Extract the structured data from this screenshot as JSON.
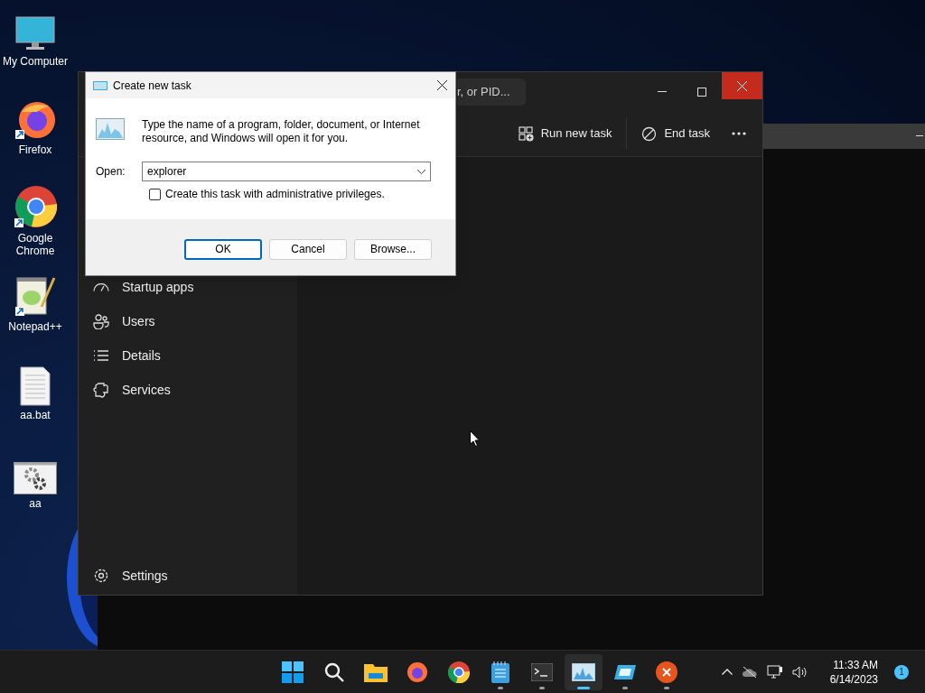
{
  "desktop_icons": [
    {
      "kind": "computer",
      "label": "My Computer"
    },
    {
      "kind": "firefox",
      "label": "Firefox"
    },
    {
      "kind": "chrome",
      "label": "Google Chrome"
    },
    {
      "kind": "notepadpp",
      "label": "Notepad++"
    },
    {
      "kind": "file",
      "label": "aa.bat"
    },
    {
      "kind": "app",
      "label": "aa"
    }
  ],
  "task_manager": {
    "search_placeholder": "r, or PID...",
    "toolbar": [
      {
        "kind": "run",
        "label": "Run new task"
      },
      {
        "kind": "end",
        "label": "End task"
      }
    ],
    "sidebar": [
      {
        "kind": "startup",
        "label": "Startup apps"
      },
      {
        "kind": "users",
        "label": "Users"
      },
      {
        "kind": "details",
        "label": "Details"
      },
      {
        "kind": "services",
        "label": "Services"
      }
    ],
    "settings": {
      "label": "Settings"
    }
  },
  "dialog": {
    "title": "Create new task",
    "description": "Type the name of a program, folder, document, or Internet resource, and Windows will open it for you.",
    "open_label": "Open:",
    "open_value": "explorer",
    "checkbox": {
      "label": "Create this task with administrative privileges.",
      "checked": false
    },
    "buttons": [
      {
        "label": "OK",
        "default": true
      },
      {
        "label": "Cancel",
        "default": false
      },
      {
        "label": "Browse...",
        "default": false
      }
    ]
  },
  "taskbar": {
    "apps": [
      {
        "kind": "start",
        "running": false,
        "selected": false
      },
      {
        "kind": "search",
        "running": false,
        "selected": false
      },
      {
        "kind": "files",
        "running": false,
        "selected": false
      },
      {
        "kind": "firefox",
        "running": false,
        "selected": false
      },
      {
        "kind": "chrome",
        "running": false,
        "selected": false
      },
      {
        "kind": "notepad",
        "running": true,
        "selected": false
      },
      {
        "kind": "terminal",
        "running": true,
        "selected": false
      },
      {
        "kind": "taskmgr",
        "running": true,
        "selected": true
      },
      {
        "kind": "window",
        "running": true,
        "selected": false
      },
      {
        "kind": "error",
        "running": true,
        "selected": false
      }
    ],
    "time": "11:33 AM",
    "date": "6/14/2023",
    "notifications": "1"
  }
}
